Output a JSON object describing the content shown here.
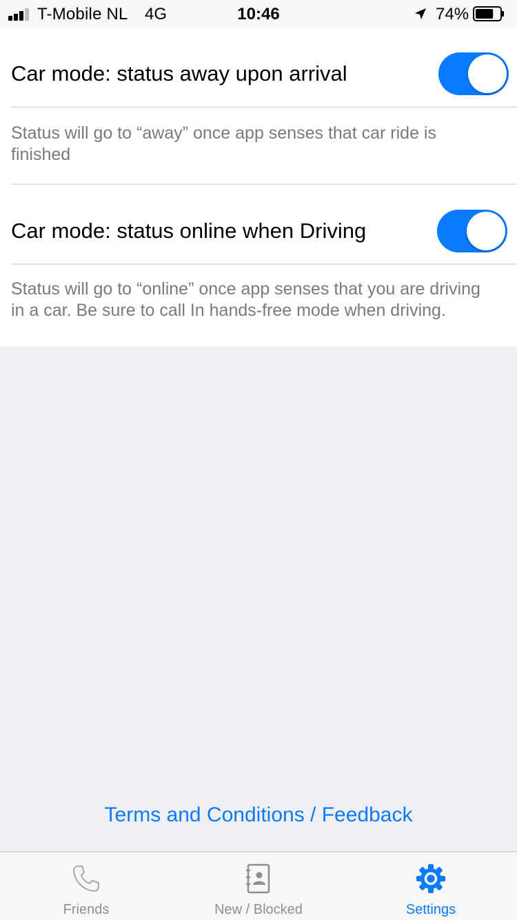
{
  "status_bar": {
    "carrier": "T-Mobile NL",
    "network": "4G",
    "time": "10:46",
    "battery_percent": "74%",
    "battery_level": 0.74,
    "signal_bars": 3
  },
  "settings": [
    {
      "title": "Car mode: status away upon arrival",
      "enabled": true,
      "description": "Status will go to “away” once app senses that car ride is finished"
    },
    {
      "title": "Car mode: status online when Driving",
      "enabled": true,
      "description": "Status will go to “online” once app senses that you are driving in a car. Be sure to call In hands-free mode when driving."
    }
  ],
  "footer": {
    "link_label": "Terms and Conditions / Feedback"
  },
  "tabs": [
    {
      "label": "Friends",
      "icon": "phone-icon",
      "active": false
    },
    {
      "label": "New / Blocked",
      "icon": "contacts-book-icon",
      "active": false
    },
    {
      "label": "Settings",
      "icon": "gear-icon",
      "active": true
    }
  ],
  "colors": {
    "accent": "#0a7aff",
    "background": "#efeff4",
    "inactive_tab": "#8e8e93",
    "description_text": "#7a7a7a"
  }
}
